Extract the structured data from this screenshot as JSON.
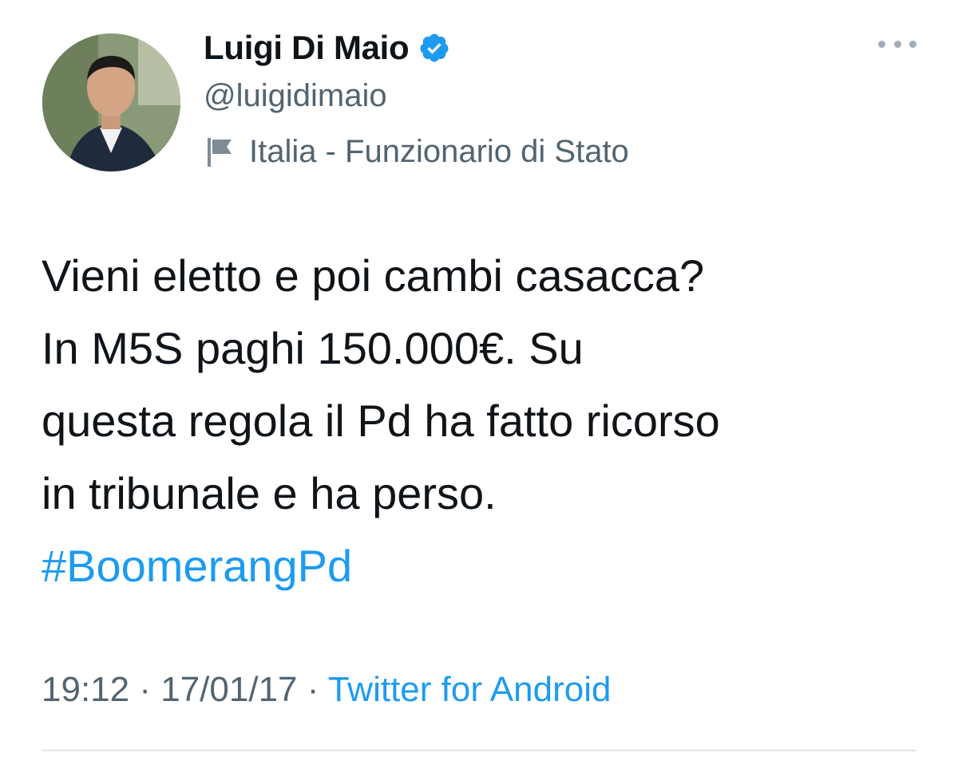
{
  "author": {
    "display_name": "Luigi Di Maio",
    "handle": "@luigidimaio",
    "verified": true,
    "label": "Italia - Funzionario di Stato"
  },
  "tweet": {
    "lines": [
      "Vieni eletto e poi cambi casacca?",
      "In M5S paghi 150.000€. Su",
      "questa regola il Pd ha fatto ricorso",
      "in tribunale e ha perso."
    ],
    "hashtag": "#BoomerangPd"
  },
  "meta": {
    "time": "19:12",
    "separator": "·",
    "date": "17/01/17",
    "source": "Twitter for Android"
  },
  "icons": {
    "verified": "verified-badge-icon",
    "label": "flag-icon",
    "more": "more-options-icon"
  },
  "colors": {
    "link": "#1d9bf0",
    "secondary_text": "#536471",
    "primary_text": "#0f1419"
  }
}
